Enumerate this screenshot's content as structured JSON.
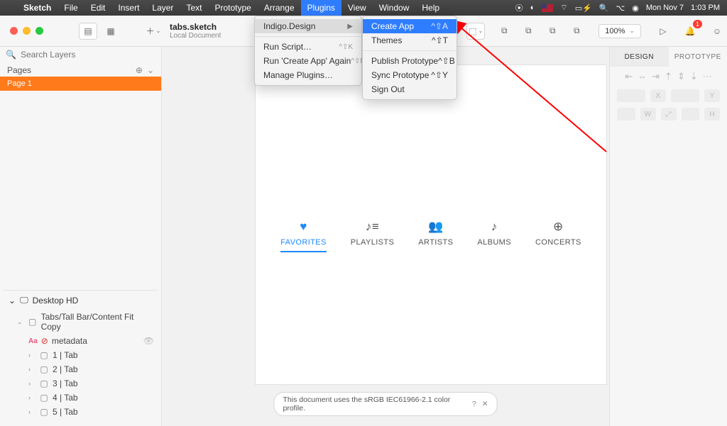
{
  "menubar": {
    "app": "Sketch",
    "items": [
      "File",
      "Edit",
      "Insert",
      "Layer",
      "Text",
      "Prototype",
      "Arrange",
      "Plugins",
      "View",
      "Window",
      "Help"
    ],
    "date": "Mon Nov 7",
    "time": "1:03 PM"
  },
  "toolbar": {
    "doc_title": "tabs.sketch",
    "doc_sub": "Local Document",
    "zoom": "100%",
    "bell_count": "1"
  },
  "left": {
    "search_placeholder": "Search Layers",
    "pages_label": "Pages",
    "page1": "Page 1",
    "desktop": "Desktop HD",
    "group": "Tabs/Tall Bar/Content Fit Copy",
    "metadata": "metadata",
    "tabs": [
      "1 | Tab",
      "2 | Tab",
      "3 | Tab",
      "4 | Tab",
      "5 | Tab"
    ]
  },
  "plugins_menu": {
    "indigo": "Indigo.Design",
    "run_script": "Run Script…",
    "run_script_sc": "^⇧K",
    "run_again": "Run 'Create App' Again",
    "run_again_sc": "^⇧R",
    "manage": "Manage Plugins…"
  },
  "submenu": {
    "create_app": "Create App",
    "create_app_sc": "^⇧A",
    "themes": "Themes",
    "themes_sc": "^⇧T",
    "publish": "Publish Prototype",
    "publish_sc": "^⇧B",
    "sync": "Sync Prototype",
    "sync_sc": "^⇧Y",
    "signout": "Sign Out"
  },
  "tabs_widget": {
    "items": [
      {
        "icon": "♥",
        "label": "FAVORITES"
      },
      {
        "icon": "♪≡",
        "label": "PLAYLISTS"
      },
      {
        "icon": "👥",
        "label": "ARTISTS"
      },
      {
        "icon": "♪",
        "label": "ALBUMS"
      },
      {
        "icon": "⊕",
        "label": "CONCERTS"
      }
    ]
  },
  "footer_note": "This document uses the sRGB IEC61966-2.1 color profile.",
  "right": {
    "tab_design": "DESIGN",
    "tab_proto": "PROTOTYPE"
  }
}
